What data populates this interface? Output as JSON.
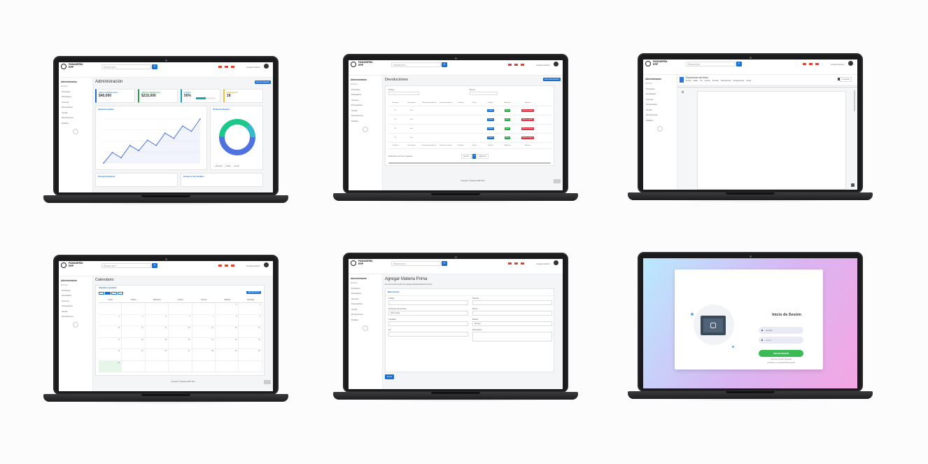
{
  "app": {
    "brand_line1": "PANADERÍA",
    "brand_line2": "ERP",
    "search_placeholder": "Buscar por...",
    "user_name": "Usuario Admin",
    "sidebar_admin": "Administración",
    "sidebar_section": "Módulos"
  },
  "sidebar_items": [
    "Productos",
    "Empleados",
    "Insumos",
    "Proveedores",
    "Ventas",
    "Devoluciones",
    "Pedidos"
  ],
  "screens": {
    "dashboard": {
      "title": "Administración",
      "report_button": "Generar Reporte",
      "stat_cards": [
        {
          "label": "VENTAS (MENSUALES)",
          "value": "$40,000",
          "color": "#1b6fd0"
        },
        {
          "label": "VENTAS (SEMANALES)",
          "value": "$215,000",
          "color": "#28a745"
        },
        {
          "label": "TAREAS",
          "value": "50%",
          "color": "#17a2b8"
        },
        {
          "label": "PENDIENTES",
          "value": "18",
          "color": "#f6c23e"
        }
      ],
      "chart_line_title": "Ganancias Anuales",
      "chart_pie_title": "Producción Registro",
      "line_chart_data": {
        "type": "line",
        "values": [
          0,
          12,
          6,
          20,
          14,
          26,
          20,
          34,
          28,
          42,
          36,
          50
        ]
      },
      "donut_legend": [
        "Mensual",
        "Diario",
        "Anual"
      ],
      "bottom_left": "Entregas Pendientes",
      "bottom_right": "Productos más Vendidos"
    },
    "devoluciones": {
      "title": "Devoluciones",
      "new_button": "Nueva Devolución",
      "show_label": "Mostrar",
      "search_label": "Buscar:",
      "headers": [
        "Producto",
        "Descripción",
        "Devolución producto",
        "Devolución cliente",
        "Cantidad",
        "Fecha",
        "Detalles",
        "Modificar",
        "Eliminar"
      ],
      "rows": [
        {
          "producto": "P1",
          "desc": "Pan"
        },
        {
          "producto": "P2",
          "desc": "Pan"
        },
        {
          "producto": "P3",
          "desc": "Pan"
        },
        {
          "producto": "P4",
          "desc": "Pan"
        }
      ],
      "btn_detail": "Detalles",
      "btn_edit": "Editar",
      "btn_delete": "Eliminar registro",
      "pagination_text": "Mostrando 1 al 4 de 4 registros",
      "prev": "Anterior",
      "page": "1",
      "next": "Siguiente",
      "footer": "Copyright © Panadería ERP 2021"
    },
    "documento": {
      "doc_title": "Documento sin título",
      "menu": [
        "Archivo",
        "Editar",
        "Ver",
        "Insertar",
        "Formato",
        "Herramientas",
        "Complementos",
        "Ayuda"
      ],
      "share": "Compartir"
    },
    "calendario": {
      "title": "Calendario",
      "subtitle": "Calendario agendado",
      "new_button": "Agendar Evento",
      "days": [
        "Lunes",
        "Martes",
        "Miércoles",
        "Jueves",
        "Viernes",
        "Sábado",
        "Domingo"
      ],
      "numbers": [
        "",
        "",
        "",
        "",
        "",
        "1",
        "2",
        "3",
        "4",
        "5",
        "6",
        "7",
        "8",
        "9",
        "10",
        "11",
        "12",
        "13",
        "14",
        "15",
        "16",
        "17",
        "18",
        "19",
        "20",
        "21",
        "22",
        "23",
        "24",
        "25",
        "26",
        "27",
        "28",
        "29",
        "30",
        "31",
        ""
      ],
      "footer": "Copyright © Panadería ERP 2021"
    },
    "materia": {
      "title": "Agregar Materia Prima",
      "subtitle": "En esta sección podremos agregar distintas Materias Primas",
      "card_title": "Materia Prima",
      "fields": [
        {
          "label": "Código",
          "value": ""
        },
        {
          "label": "Nombre",
          "value": ""
        },
        {
          "label": "Fecha de Vencimiento",
          "value": "dd/mm/aaaa"
        },
        {
          "label": "Precio",
          "value": ""
        },
        {
          "label": "Cantidad",
          "value": ""
        },
        {
          "label": "Estado",
          "value": "Escoger"
        },
        {
          "label": "Iva",
          "value": ""
        },
        {
          "label": "Descripción",
          "value": ""
        }
      ],
      "save": "Enviar"
    },
    "login": {
      "title": "Inicio de Sesión",
      "user_placeholder": "usuario",
      "pass_placeholder": "••••••••",
      "button": "INICIAR SESIÓN",
      "link1": "¿No tienes cuenta? Regístrate",
      "link2": "¿Olvidaste tu contraseña? Recuperarla"
    }
  }
}
